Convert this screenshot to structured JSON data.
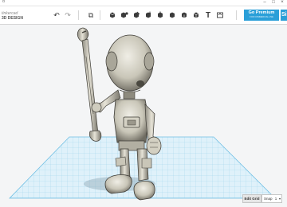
{
  "app": {
    "title": "d"
  },
  "brand": {
    "line1": "tinkercad",
    "line2": "3D DESIGN"
  },
  "toolbar": {
    "undo_icon": "undo-icon",
    "redo_icon": "redo-icon",
    "premium_label": "Go Premium",
    "premium_sub": "FOR COMMERCIAL USE",
    "sign_label": "Si"
  },
  "footer": {
    "edit_grid": "Edit Grid",
    "snap_label": "Snap",
    "snap_value": "1"
  },
  "colors": {
    "accent": "#2a9fd8",
    "grid": "#9fd3ec",
    "model": "#dcd9cc"
  }
}
